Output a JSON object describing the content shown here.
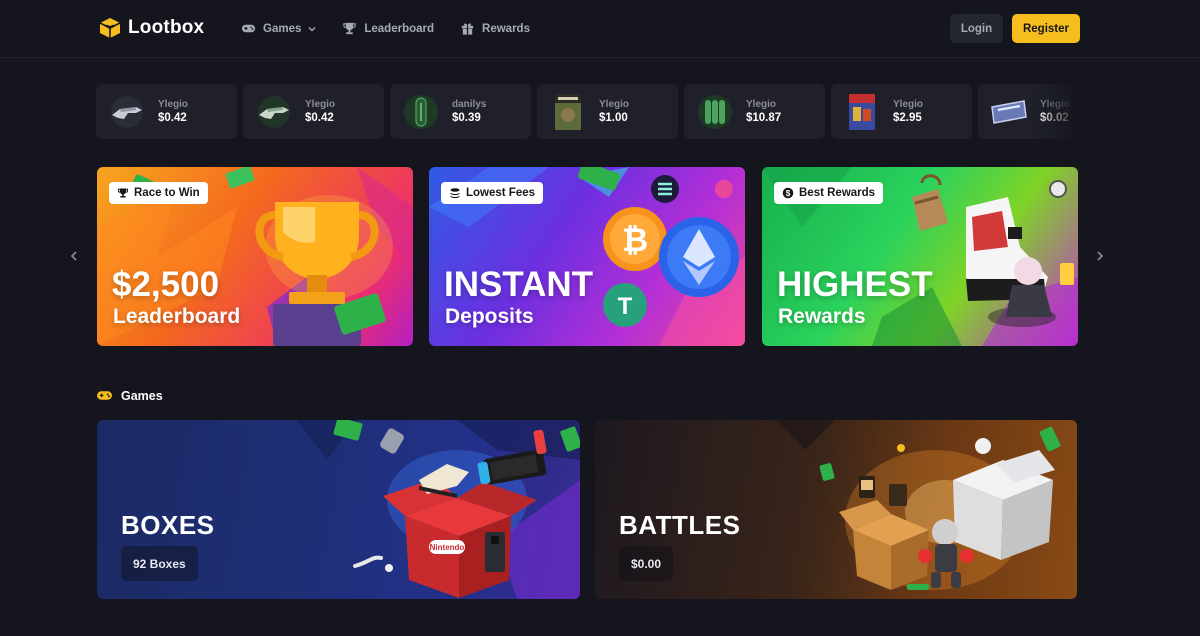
{
  "brand": {
    "name": "Lootbox",
    "accent": "#f5be1e",
    "icon": "box-logo-icon"
  },
  "nav": [
    {
      "label": "Games",
      "icon": "gamepad-icon",
      "dropdown": true
    },
    {
      "label": "Leaderboard",
      "icon": "trophy-icon"
    },
    {
      "label": "Rewards",
      "icon": "gift-icon"
    }
  ],
  "auth": {
    "login": "Login",
    "register": "Register"
  },
  "drops": [
    {
      "user": "Ylegio",
      "price": "$0.42",
      "icon": "rifle-skin-icon"
    },
    {
      "user": "Ylegio",
      "price": "$0.42",
      "icon": "rifle-skin-icon"
    },
    {
      "user": "danilys",
      "price": "$0.39",
      "icon": "capsule-icon"
    },
    {
      "user": "Ylegio",
      "price": "$1.00",
      "icon": "game-cover-icon"
    },
    {
      "user": "Ylegio",
      "price": "$10.87",
      "icon": "capsule-set-icon"
    },
    {
      "user": "Ylegio",
      "price": "$2.95",
      "icon": "game-cover-icon"
    },
    {
      "user": "Ylegio",
      "price": "$0.02",
      "icon": "sticker-icon"
    }
  ],
  "banners": [
    {
      "chip": "Race to Win",
      "chip_icon": "trophy-icon",
      "title": "$2,500",
      "subtitle": "Leaderboard"
    },
    {
      "chip": "Lowest Fees",
      "chip_icon": "coins-icon",
      "title": "INSTANT",
      "subtitle": "Deposits"
    },
    {
      "chip": "Best Rewards",
      "chip_icon": "dollar-icon",
      "title": "HIGHEST",
      "subtitle": "Rewards"
    }
  ],
  "games_section": {
    "title": "Games",
    "icon": "gamepad-icon"
  },
  "games": [
    {
      "title": "BOXES",
      "badge": "92 Boxes"
    },
    {
      "title": "BATTLES",
      "badge": "$0.00"
    }
  ]
}
